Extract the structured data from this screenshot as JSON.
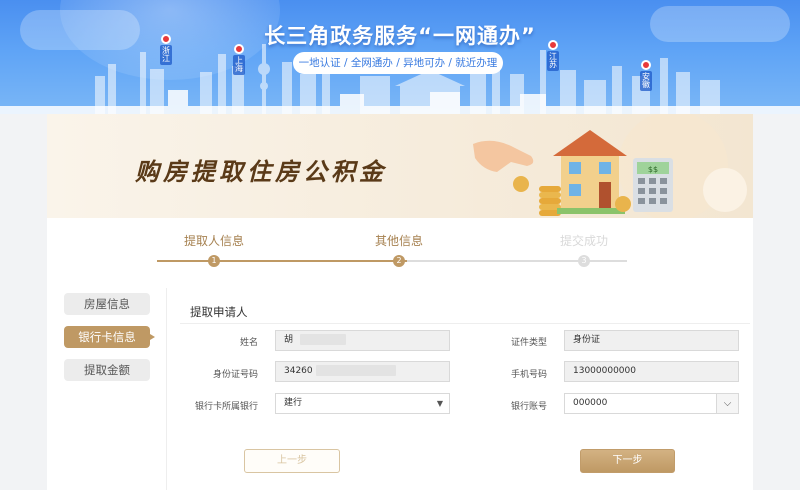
{
  "banner": {
    "title": "长三角政务服务“一网通办”",
    "subtitle": "一地认证 / 全网通办 / 异地可办 / 就近办理",
    "regions": [
      "浙江",
      "上海",
      "江苏",
      "安徽"
    ]
  },
  "hero": {
    "title": "购房提取住房公积金",
    "calculator_display": "$$"
  },
  "steps": [
    {
      "label": "提取人信息",
      "number": "1",
      "status": "done"
    },
    {
      "label": "其他信息",
      "number": "2",
      "status": "done"
    },
    {
      "label": "提交成功",
      "number": "3",
      "status": "todo"
    }
  ],
  "sidebar": {
    "items": [
      {
        "label": "房屋信息",
        "active": false
      },
      {
        "label": "银行卡信息",
        "active": true
      },
      {
        "label": "提取金额",
        "active": false
      }
    ]
  },
  "form": {
    "section_title": "提取申请人",
    "name": {
      "label": "姓名",
      "value": "胡"
    },
    "id_type": {
      "label": "证件类型",
      "value": "身份证"
    },
    "id_number": {
      "label": "身份证号码",
      "value": "34260"
    },
    "phone": {
      "label": "手机号码",
      "value": "13000000000"
    },
    "bank": {
      "label": "银行卡所属银行",
      "value": "建行",
      "caret": "▼"
    },
    "account": {
      "label": "银行账号",
      "value": "000000",
      "caret": "⌵"
    }
  },
  "buttons": {
    "prev": "上一步",
    "next": "下一步"
  },
  "colors": {
    "accent": "#bf9964",
    "banner_blue": "#5fa4f6",
    "step_inactive": "#d9d9d9"
  }
}
